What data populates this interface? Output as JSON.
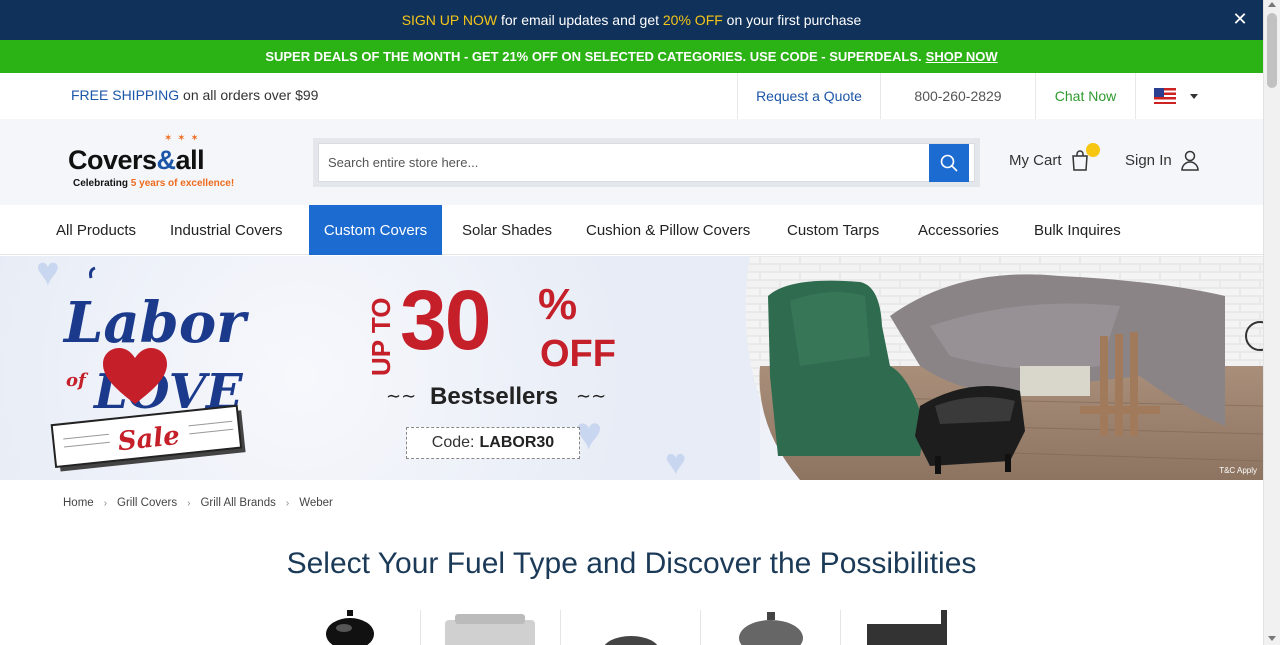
{
  "signup_bar": {
    "highlight_1": "SIGN UP NOW",
    "text_1": " for email updates and get ",
    "highlight_2": "20% OFF",
    "text_2": " on your first purchase",
    "close_icon": "close-icon"
  },
  "deals_bar": {
    "text": "SUPER DEALS OF THE MONTH - GET 21% OFF ON SELECTED CATEGORIES. USE CODE - SUPERDEALS.",
    "link": "SHOP NOW"
  },
  "utility": {
    "shipping_bold": "FREE SHIPPING",
    "shipping_rest": " on all orders over $99",
    "quote": "Request a Quote",
    "phone": "800-260-2829",
    "chat": "Chat Now",
    "country_flag": "us-flag-icon"
  },
  "header": {
    "logo_word_1": "Covers",
    "logo_amp": "&",
    "logo_word_2": "all",
    "logo_tagline_1": "Celebrating ",
    "logo_tagline_2": "5 years of excellence!",
    "search_placeholder": "Search entire store here...",
    "cart_label": "My Cart",
    "signin_label": "Sign In"
  },
  "nav": {
    "items": [
      {
        "label": "All Products"
      },
      {
        "label": "Industrial Covers"
      },
      {
        "label": "Custom Covers"
      },
      {
        "label": "Solar Shades"
      },
      {
        "label": "Cushion & Pillow Covers"
      },
      {
        "label": "Custom Tarps"
      },
      {
        "label": "Accessories"
      },
      {
        "label": "Bulk Inquires"
      }
    ],
    "active": "Custom Covers"
  },
  "banner": {
    "script_labor": "Labor",
    "script_of": "of",
    "script_love": "LOVE",
    "script_sale": "Sale",
    "up_to": "UP TO",
    "amount": "30",
    "percent": "%",
    "off": "OFF",
    "subtitle": "Bestsellers",
    "code_label": "Code:",
    "code_value": "LABOR30",
    "terms": "T&C Apply"
  },
  "breadcrumb": [
    "Home",
    "Grill Covers",
    "Grill All Brands",
    "Weber"
  ],
  "fuel_section": {
    "heading": "Select Your Fuel Type and Discover the Possibilities"
  },
  "colors": {
    "navy": "#10315a",
    "green": "#2bb214",
    "blue": "#1c6bd0",
    "red": "#c51f2a",
    "yellow": "#f5c518"
  }
}
